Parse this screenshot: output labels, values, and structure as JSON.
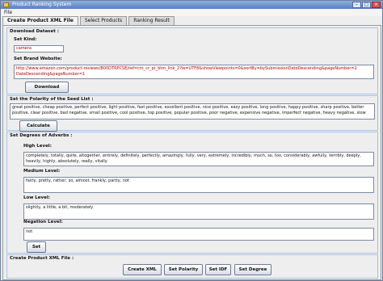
{
  "window": {
    "title": "Product Ranking System"
  },
  "menu": {
    "file": "File"
  },
  "tabs": [
    "Create Product XML File",
    "Select Products",
    "Ranking Result"
  ],
  "download": {
    "group_title": "Download Dataset :",
    "kind_label": "Set Kind:",
    "kind_value": "camera",
    "website_label": "Set Brand Website:",
    "website_value": "http://www.amazon.com/product-reviews/B00DTRPCSE/ref=cm_cr_pr_btm_link_2?ie=UTF8&showViewpoints=0&sortBy=bySubmissionDateDescending&pageNumber=2",
    "website_value_2": "DateDescending&pageNumber=1",
    "download_button": "Download"
  },
  "polarity": {
    "group_title": "Set the Polarity of the Seed List :",
    "text": "great positive, cheap positive, perfect positive, light positive, fast positive, excellent positive, nice positive, easy positive, long positive, happy positive, sharp positive, better positive, clear positive, bad negative, small positive, cool positive, top positive, popular positive, poor negative, expensive negative, imperfect negative, heavy negative, slow",
    "calculate_button": "Calculate"
  },
  "adverbs": {
    "group_title": "Set Degrees of Adverbs :",
    "high_label": "High Level:",
    "high_value": "completely, totally, quite, altogether, entirely, definitely, perfectly, amazingly, fully, very, extremely, incredibly, much, so, too, considerably, awfully, terribly, deeply, heavily, highly, absolutely, really, vitally",
    "medium_label": "Medium Level:",
    "medium_value": "fairly, pretty, rather, so, almost, frankly, partly, not",
    "low_label": "Low Level:",
    "low_value": "slightly, a little, a bit, moderately",
    "negation_label": "Negation Level:",
    "negation_value": "not",
    "set_button": "Set"
  },
  "create": {
    "group_title": "Create Product XML File :",
    "buttons": [
      "Create XML",
      "Set Polarity",
      "Set IDF",
      "Set Degree"
    ]
  }
}
